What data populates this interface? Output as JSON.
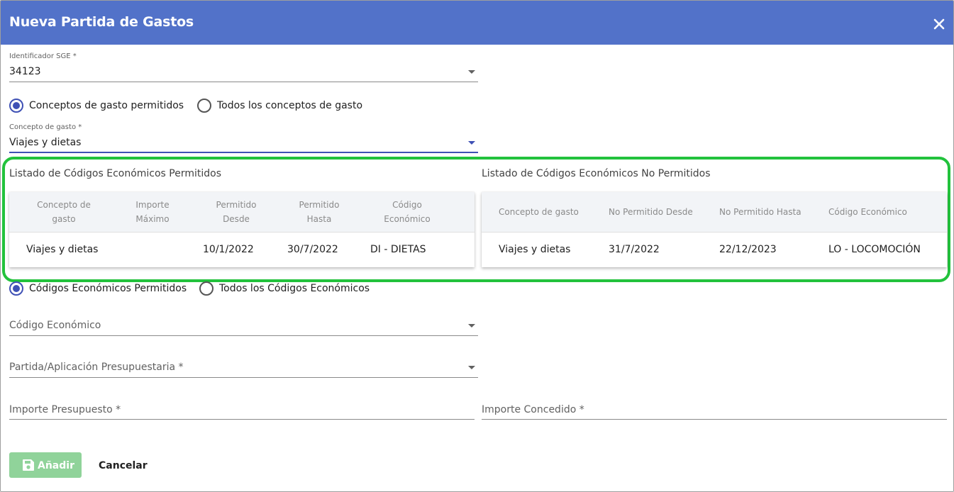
{
  "dialog": {
    "title": "Nueva Partida de Gastos"
  },
  "sge": {
    "label": "Identificador SGE *",
    "value": "34123"
  },
  "concepto_mode": {
    "options": [
      "Conceptos de gasto permitidos",
      "Todos los conceptos de gasto"
    ],
    "selected": "Conceptos de gasto permitidos"
  },
  "concepto": {
    "label": "Concepto de gasto *",
    "value": "Viajes y dietas"
  },
  "permitidos": {
    "title": "Listado de Códigos Económicos Permitidos",
    "headers": [
      [
        "Concepto de",
        "gasto"
      ],
      [
        "Importe",
        "Máximo"
      ],
      [
        "Permitido",
        "Desde"
      ],
      [
        "Permitido",
        "Hasta"
      ],
      [
        "Código",
        "Económico"
      ]
    ],
    "rows": [
      [
        "Viajes y dietas",
        "",
        "10/1/2022",
        "30/7/2022",
        "DI - DIETAS"
      ]
    ]
  },
  "no_permitidos": {
    "title": "Listado de Códigos Económicos No Permitidos",
    "headers": [
      "Concepto de gasto",
      "No Permitido Desde",
      "No Permitido Hasta",
      "Código Económico"
    ],
    "rows": [
      [
        "Viajes y dietas",
        "31/7/2022",
        "22/12/2023",
        "LO - LOCOMOCIÓN"
      ]
    ]
  },
  "codigo_mode": {
    "options": [
      "Códigos Económicos Permitidos",
      "Todos los Códigos Económicos"
    ],
    "selected": "Códigos Económicos Permitidos"
  },
  "codigo_economico": {
    "placeholder": "Código Económico"
  },
  "partida": {
    "placeholder": "Partida/Aplicación Presupuestaria *"
  },
  "importe_presupuesto": {
    "placeholder": "Importe Presupuesto *"
  },
  "importe_concedido": {
    "placeholder": "Importe Concedido *"
  },
  "actions": {
    "add_label": "Añadir",
    "cancel_label": "Cancelar"
  },
  "colors": {
    "header": "#5272c9",
    "primary": "#3f51b5",
    "highlight": "#22c23c",
    "add_button": "#90d39a"
  },
  "icons": {
    "close": "close-icon",
    "save": "save-icon",
    "dropdown": "chevron-down-icon"
  }
}
